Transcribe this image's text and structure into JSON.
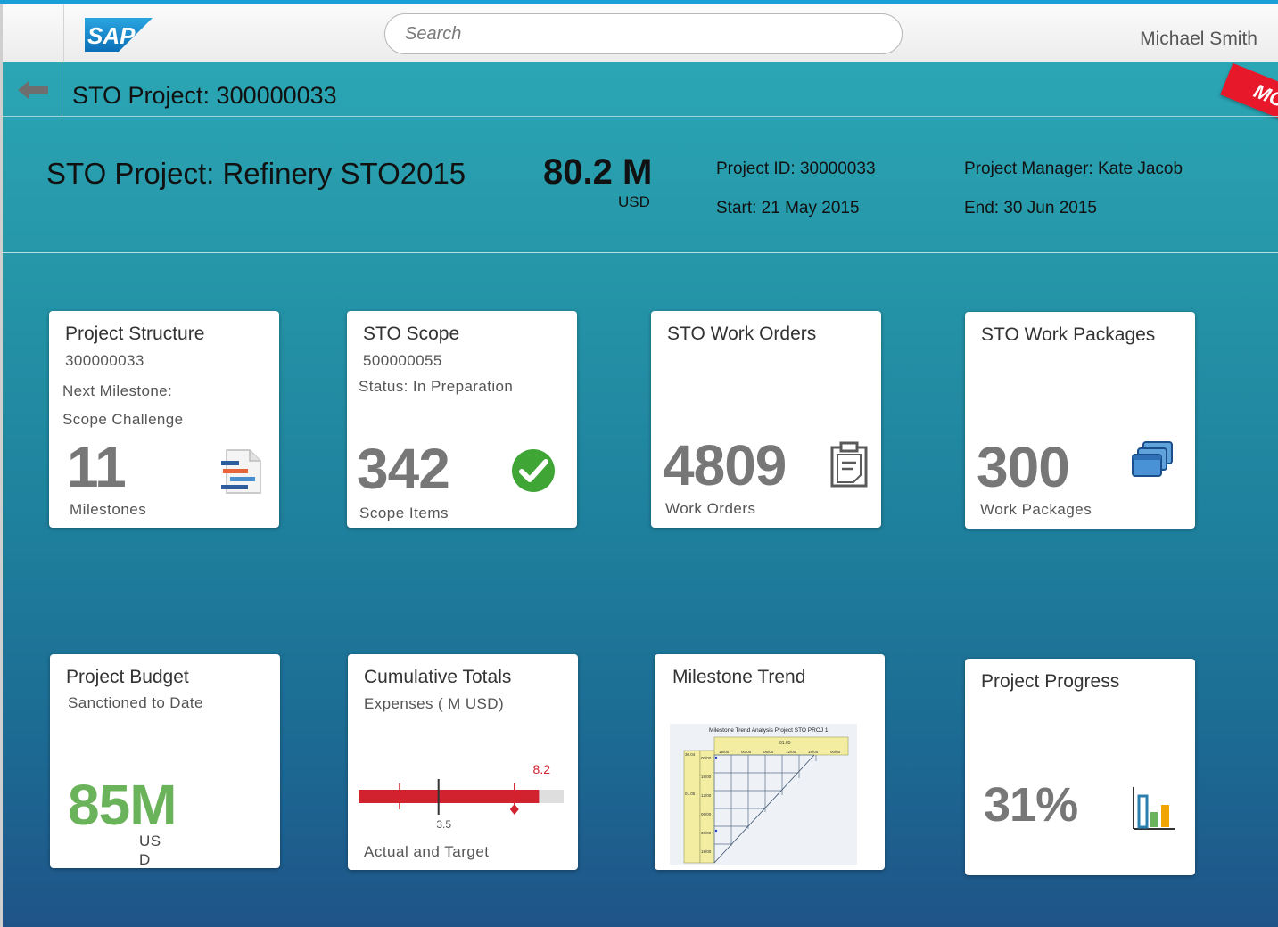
{
  "shell": {
    "logo_text": "SAP",
    "search_placeholder": "Search",
    "user_name": "Michael Smith"
  },
  "subheader": {
    "title": "STO Project: 300000033",
    "ribbon_text": "MO"
  },
  "object_header": {
    "title": "STO Project: Refinery STO2015",
    "number": "80.2 M",
    "unit": "USD",
    "project_id": "Project ID: 30000033",
    "start": "Start: 21 May 2015",
    "manager": "Project Manager: Kate Jacob",
    "end": "End: 30 Jun 2015"
  },
  "tiles": {
    "structure": {
      "title": "Project Structure",
      "id": "300000033",
      "next_label": "Next Milestone:",
      "next_value": "Scope Challenge",
      "number": "11",
      "footer": "Milestones",
      "icon": "gantt-document-icon"
    },
    "scope": {
      "title": "STO Scope",
      "id": "500000055",
      "status": "Status: In Preparation",
      "number": "342",
      "footer": "Scope Items",
      "icon": "checkmark-icon"
    },
    "work_orders": {
      "title": "STO Work Orders",
      "number": "4809",
      "footer": "Work Orders",
      "icon": "clipboard-icon"
    },
    "work_packages": {
      "title": "STO Work Packages",
      "number": "300",
      "footer": "Work Packages",
      "icon": "stacked-windows-icon"
    },
    "budget": {
      "title": "Project Budget",
      "subtitle": "Sanctioned to Date",
      "number": "85M",
      "unit_line1": "US",
      "unit_line2": "D",
      "color": "#6ab35a"
    },
    "cumulative": {
      "title": "Cumulative Totals",
      "subtitle": "Expenses ( M USD)",
      "actual_label": "8.2",
      "target_label": "3.5",
      "footer": "Actual and Target",
      "bar_color": "#d3222f",
      "actual_fraction": 0.88,
      "target_fraction": 0.39,
      "forecast_fraction": 0.76
    },
    "milestone_trend": {
      "title": "Milestone Trend",
      "chart_title": "Milestone Trend Analysis Project STO PROJ 1",
      "top_group": "01.05",
      "top_cols": [
        "18/00",
        "00/00",
        "06/00",
        "12/00",
        "18/00",
        "00/00"
      ],
      "left_groups": [
        "30.04",
        "01.05"
      ],
      "left_rows": [
        "00/00",
        "18/00",
        "12/00",
        "06/00",
        "00/00",
        "18/00"
      ]
    },
    "progress": {
      "title": "Project Progress",
      "number": "31%",
      "icon": "bar-chart-icon"
    }
  }
}
